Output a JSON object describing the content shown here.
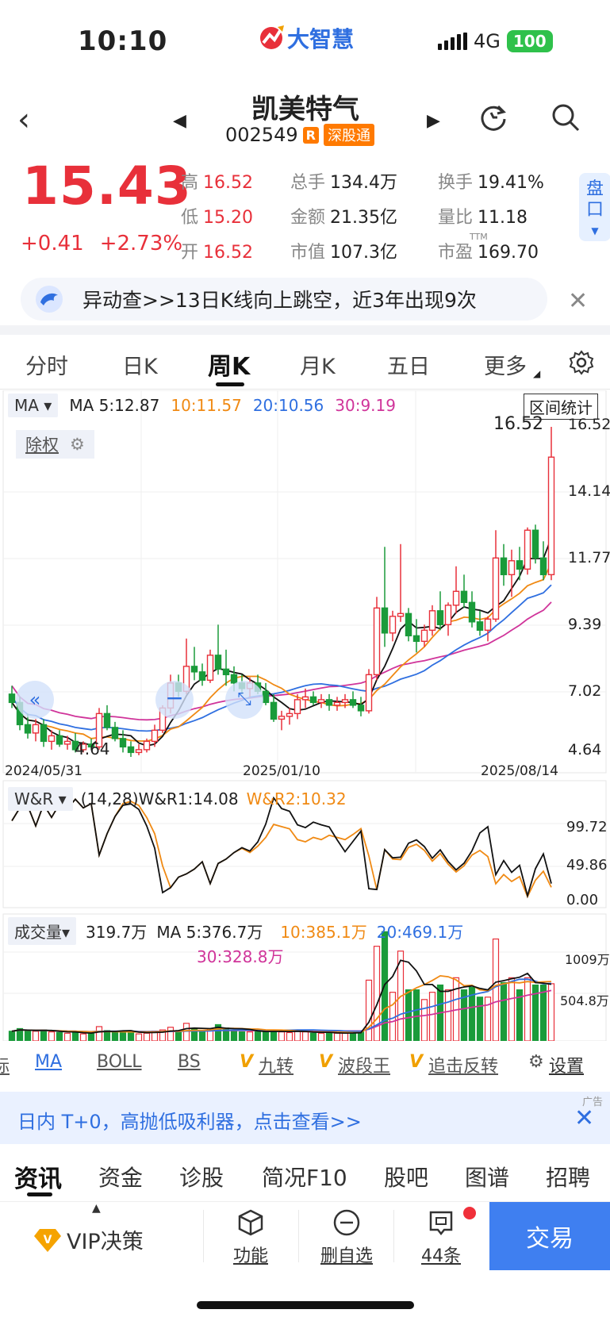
{
  "status_bar": {
    "time": "10:10",
    "network": "4G",
    "battery": "100",
    "logo_text": "大智慧"
  },
  "header": {
    "name": "凯美特气",
    "code": "002549",
    "badge_r": "R",
    "badge_market": "深股通"
  },
  "quote": {
    "price": "15.43",
    "change": "+0.41",
    "change_pct": "+2.73%",
    "high_label": "高",
    "high": "16.52",
    "low_label": "低",
    "low": "15.20",
    "open_label": "开",
    "open": "16.52",
    "volume_label": "总手",
    "volume": "134.4万",
    "amount_label": "金额",
    "amount": "21.35亿",
    "mcap_label": "市值",
    "mcap": "107.3亿",
    "turnover_label": "换手",
    "turnover": "19.41%",
    "vol_ratio_label": "量比",
    "vol_ratio": "11.18",
    "pe_label": "市盈",
    "pe_sup": "TTM",
    "pe": "169.70",
    "pankou": "盘口"
  },
  "alert": {
    "text": "异动查>>13日K线向上跳空，近3年出现9次"
  },
  "period_tabs": [
    "分时",
    "日K",
    "周K",
    "月K",
    "五日",
    "更多"
  ],
  "active_period": "周K",
  "ma_legend": {
    "selector": "MA",
    "ma5": "MA 5:12.87",
    "ma10": "10:11.57",
    "ma20": "20:10.56",
    "ma30": "30:9.19",
    "range_stats": "区间统计"
  },
  "chu_quan": "除权",
  "price_axis": [
    "16.52",
    "14.14",
    "11.77",
    "9.39",
    "7.02",
    "4.64"
  ],
  "date_axis": [
    "2024/05/31",
    "2025/01/10",
    "2025/08/14"
  ],
  "max_label": "16.52",
  "min_label": "4.64",
  "wr_legend": {
    "selector": "W&R",
    "params": "(14,28)",
    "wr1": "W&R1:14.08",
    "wr2": "W&R2:10.32"
  },
  "wr_axis": [
    "99.72",
    "49.86",
    "0.00"
  ],
  "vol_legend": {
    "selector": "成交量",
    "current": "319.7万",
    "ma5": "MA 5:376.7万",
    "ma10": "10:385.1万",
    "ma20": "20:469.1万",
    "ma30": "30:328.8万"
  },
  "vol_axis": [
    "1009万",
    "504.8万"
  ],
  "indicator_tabs": [
    "标",
    "MA",
    "BOLL",
    "BS",
    "九转",
    "波段王",
    "追击反转",
    "设置"
  ],
  "ad": {
    "text": "日内 T+0，高抛低吸利器，点击查看>>",
    "tag": "广告"
  },
  "info_tabs": [
    "资讯",
    "资金",
    "诊股",
    "简况F10",
    "股吧",
    "图谱",
    "招聘"
  ],
  "bottom_bar": {
    "vip": "VIP决策",
    "func": "功能",
    "remove": "删自选",
    "msg": "44条",
    "trade": "交易"
  },
  "colors": {
    "up": "#e8303a",
    "down": "#1a9b3a",
    "ma10": "#f08a14",
    "ma20": "#2f6fe0",
    "ma30": "#d0349a",
    "accent": "#3f7ff0"
  },
  "chart_data": [
    {
      "type": "candlestick",
      "title": "周K",
      "ylim": [
        4.64,
        16.52
      ],
      "x_ticks": [
        "2024/05/31",
        "2025/01/10",
        "2025/08/14"
      ],
      "candles": [
        [
          6.9,
          7.2,
          6.4,
          6.6
        ],
        [
          6.6,
          6.8,
          5.6,
          5.8
        ],
        [
          5.8,
          6.2,
          5.3,
          5.5
        ],
        [
          5.5,
          6.0,
          5.2,
          5.8
        ],
        [
          5.8,
          6.0,
          5.0,
          5.2
        ],
        [
          5.2,
          5.6,
          4.9,
          5.4
        ],
        [
          5.4,
          5.6,
          5.0,
          5.1
        ],
        [
          5.1,
          5.4,
          4.9,
          5.2
        ],
        [
          5.2,
          5.5,
          4.8,
          4.9
        ],
        [
          4.9,
          5.2,
          4.8,
          5.1
        ],
        [
          5.1,
          5.3,
          4.9,
          5.0
        ],
        [
          5.0,
          6.4,
          4.9,
          6.2
        ],
        [
          6.2,
          6.5,
          5.6,
          5.7
        ],
        [
          5.7,
          5.9,
          5.2,
          5.3
        ],
        [
          5.3,
          5.6,
          4.8,
          5.0
        ],
        [
          5.0,
          5.2,
          4.64,
          4.8
        ],
        [
          4.8,
          5.1,
          4.7,
          4.9
        ],
        [
          4.9,
          5.3,
          4.8,
          5.2
        ],
        [
          5.2,
          5.8,
          5.0,
          5.6
        ],
        [
          5.6,
          6.5,
          5.5,
          6.4
        ],
        [
          6.4,
          7.6,
          6.2,
          7.3
        ],
        [
          7.3,
          7.6,
          6.8,
          7.0
        ],
        [
          7.0,
          8.9,
          6.9,
          7.9
        ],
        [
          7.9,
          8.6,
          7.4,
          7.7
        ],
        [
          7.7,
          8.0,
          7.2,
          7.4
        ],
        [
          7.4,
          8.5,
          7.3,
          8.3
        ],
        [
          8.3,
          9.4,
          7.6,
          7.8
        ],
        [
          7.8,
          8.5,
          7.2,
          7.6
        ],
        [
          7.6,
          7.9,
          7.0,
          7.3
        ],
        [
          7.3,
          7.6,
          6.9,
          7.1
        ],
        [
          7.1,
          7.5,
          6.8,
          7.3
        ],
        [
          7.3,
          7.6,
          6.9,
          7.0
        ],
        [
          7.0,
          7.3,
          6.5,
          6.6
        ],
        [
          6.6,
          6.9,
          5.9,
          6.0
        ],
        [
          6.0,
          6.3,
          5.6,
          6.1
        ],
        [
          6.1,
          6.4,
          5.8,
          6.2
        ],
        [
          6.2,
          6.9,
          6.0,
          6.7
        ],
        [
          6.7,
          7.1,
          6.4,
          6.8
        ],
        [
          6.8,
          7.0,
          6.5,
          6.6
        ],
        [
          6.6,
          6.9,
          6.4,
          6.7
        ],
        [
          6.7,
          6.9,
          6.3,
          6.5
        ],
        [
          6.5,
          6.8,
          6.3,
          6.6
        ],
        [
          6.6,
          6.9,
          6.4,
          6.7
        ],
        [
          6.7,
          7.0,
          6.4,
          6.5
        ],
        [
          6.5,
          6.8,
          6.1,
          6.3
        ],
        [
          6.3,
          7.8,
          6.2,
          7.6
        ],
        [
          7.6,
          10.4,
          7.4,
          10.0
        ],
        [
          10.0,
          12.2,
          8.6,
          9.1
        ],
        [
          9.1,
          9.9,
          8.8,
          9.7
        ],
        [
          9.7,
          12.3,
          9.5,
          9.8
        ],
        [
          9.8,
          10.0,
          8.8,
          9.0
        ],
        [
          9.0,
          9.6,
          8.4,
          8.8
        ],
        [
          8.8,
          9.4,
          8.6,
          9.2
        ],
        [
          9.2,
          10.1,
          9.0,
          9.9
        ],
        [
          9.9,
          10.6,
          9.2,
          9.4
        ],
        [
          9.4,
          10.2,
          9.0,
          10.1
        ],
        [
          10.1,
          11.5,
          9.8,
          10.6
        ],
        [
          10.6,
          11.2,
          10.0,
          10.2
        ],
        [
          10.2,
          10.6,
          9.3,
          9.5
        ],
        [
          9.5,
          9.9,
          9.0,
          9.2
        ],
        [
          9.2,
          9.7,
          8.8,
          9.6
        ],
        [
          9.6,
          12.8,
          9.5,
          11.8
        ],
        [
          11.8,
          12.3,
          10.8,
          11.2
        ],
        [
          11.2,
          12.1,
          10.4,
          11.7
        ],
        [
          11.7,
          12.2,
          11.0,
          11.4
        ],
        [
          11.4,
          12.9,
          11.2,
          12.8
        ],
        [
          12.8,
          13.0,
          11.6,
          11.8
        ],
        [
          11.8,
          12.4,
          11.0,
          11.2
        ],
        [
          11.2,
          16.52,
          11.0,
          15.43
        ]
      ]
    },
    {
      "type": "line",
      "title": "W&R",
      "ylim": [
        0,
        99.72
      ],
      "series": [
        {
          "name": "W&R1:14.08",
          "last": 14.08
        },
        {
          "name": "W&R2:10.32",
          "last": 10.32
        }
      ]
    },
    {
      "type": "bar",
      "title": "成交量",
      "ylim": [
        0,
        1009
      ],
      "unit": "万",
      "series": [
        {
          "name": "319.7万",
          "last": 319.7
        }
      ]
    }
  ]
}
